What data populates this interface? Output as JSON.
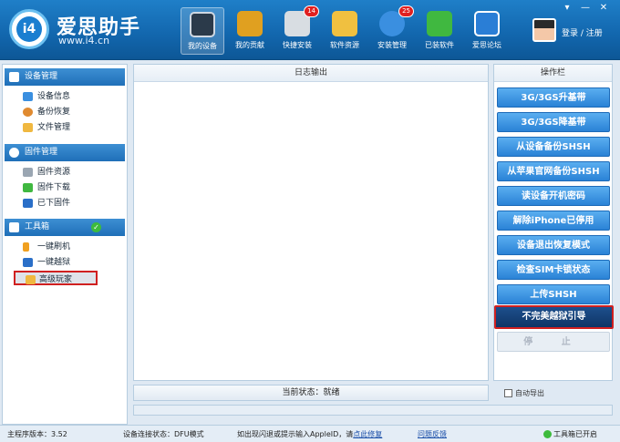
{
  "app": {
    "name": "爱思助手",
    "url": "www.i4.cn",
    "logo_text": "i4"
  },
  "nav": [
    {
      "label": "我的设备",
      "icon": "phone-icon",
      "color": "#2b3a4a"
    },
    {
      "label": "我的贡献",
      "icon": "chart-icon",
      "color": "#e0a020"
    },
    {
      "label": "快捷安装",
      "icon": "install-icon",
      "color": "#d8dde2",
      "badge": "14"
    },
    {
      "label": "软件资源",
      "icon": "apps-icon",
      "color": "#f0c040"
    },
    {
      "label": "安装管理",
      "icon": "download-icon",
      "color": "#3a8fe0",
      "badge": "25"
    },
    {
      "label": "已装软件",
      "icon": "check-icon",
      "color": "#40b840"
    },
    {
      "label": "爱思论坛",
      "icon": "forum-icon",
      "color": "#2a7ed6"
    }
  ],
  "user": {
    "login": "登录 / 注册"
  },
  "window_controls": [
    "▾",
    "—",
    "✕"
  ],
  "sidebar": {
    "sections": [
      {
        "title": "设备管理",
        "items": [
          "设备信息",
          "备份恢复",
          "文件管理"
        ]
      },
      {
        "title": "固件管理",
        "items": [
          "固件资源",
          "固件下载",
          "已下固件"
        ]
      },
      {
        "title": "工具箱",
        "items": [
          "一键刷机",
          "一键越狱",
          "高级玩家"
        ]
      }
    ]
  },
  "log": {
    "title": "日志输出"
  },
  "status": {
    "text": "当前状态：就绪"
  },
  "actions": {
    "title": "操作栏",
    "buttons": [
      "3G/3GS升基带",
      "3G/3GS降基带",
      "从设备备份SHSH",
      "从苹果官网备份SHSH",
      "读设备开机密码",
      "解除iPhone已停用",
      "设备退出恢复模式",
      "检查SIM卡锁状态",
      "上传SHSH",
      "不完美越狱引导",
      "停 止"
    ],
    "auto_export": "自动导出"
  },
  "footer": {
    "version": "主程序版本：3.52",
    "connection": "设备连接状态：DFU模式",
    "tip_prefix": "如出现闪退或提示输入AppleID，请",
    "tip_link": "点此修复",
    "feedback": "问题反馈",
    "toolbox": "工具箱已开启"
  }
}
